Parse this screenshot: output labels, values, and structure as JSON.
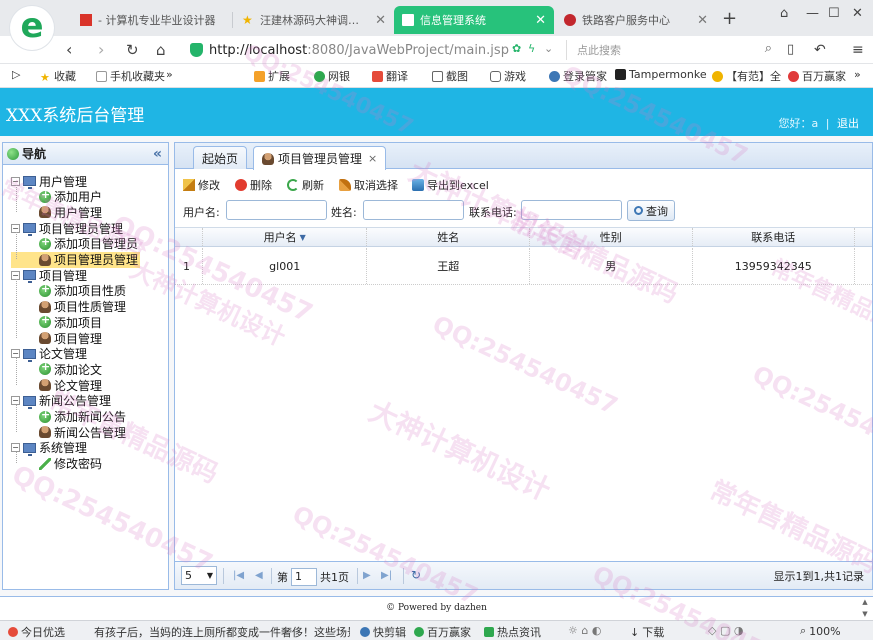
{
  "browser": {
    "tabs": [
      {
        "label": "- 计算机专业毕业设计器",
        "icon": "red-flag-icon"
      },
      {
        "label": "汪建林源码大神调试的C",
        "icon": "star-icon"
      },
      {
        "label": "信息管理系统",
        "icon": "document-icon",
        "active": true
      },
      {
        "label": "铁路客户服务中心",
        "icon": "railway-icon"
      }
    ],
    "new_tab": "+",
    "url_host": "http://localhost",
    "url_rest": ":8080/JavaWebProject/main.jsp",
    "search_placeholder": "点此搜索",
    "bookmarks": [
      "收藏",
      "手机收藏夹",
      "»",
      "扩展",
      "网银",
      "翻译",
      "截图",
      "游戏",
      "登录管家",
      "Tampermonke",
      "【有范】全",
      "百万赢家",
      "»"
    ]
  },
  "header": {
    "app_title": "XXX系统后台管理",
    "greeting": "您好：a",
    "separator": "|",
    "logout_label": "退出"
  },
  "sidebar": {
    "title": "导航",
    "groups": [
      {
        "label": "用户管理",
        "items": [
          "添加用户",
          "用户管理"
        ]
      },
      {
        "label": "项目管理员管理",
        "items": [
          "添加项目管理员",
          "项目管理员管理"
        ]
      },
      {
        "label": "项目管理",
        "items": [
          "添加项目性质",
          "项目性质管理",
          "添加项目",
          "项目管理"
        ]
      },
      {
        "label": "论文管理",
        "items": [
          "添加论文",
          "论文管理"
        ]
      },
      {
        "label": "新闻公告管理",
        "items": [
          "添加新闻公告",
          "新闻公告管理"
        ]
      },
      {
        "label": "系统管理",
        "items": [
          "修改密码"
        ]
      }
    ],
    "selected": "项目管理员管理"
  },
  "main": {
    "tabs": [
      {
        "label": "起始页"
      },
      {
        "label": "项目管理员管理",
        "close": "×"
      }
    ],
    "toolbar": {
      "edit": "修改",
      "delete": "删除",
      "refresh": "刷新",
      "cancel_select": "取消选择",
      "export": "导出到excel"
    },
    "search": {
      "username_label": "用户名:",
      "name_label": "姓名:",
      "phone_label": "联系电话:",
      "query_button": "查询"
    },
    "table": {
      "columns": [
        "用户名",
        "姓名",
        "性别",
        "联系电话"
      ],
      "rows": [
        {
          "num": "1",
          "cells": [
            "gl001",
            "王超",
            "男",
            "13959342345"
          ]
        }
      ]
    },
    "pager": {
      "page_size": "5",
      "page_prefix": "第",
      "page_value": "1",
      "page_suffix": "共1页",
      "summary": "显示1到1,共1记录"
    }
  },
  "footer": {
    "text": "© Powered by dazhen"
  },
  "statusbar": {
    "items": [
      "今日优选",
      "有孩子后，当妈的连上厕所都变成一件奢侈！这些场景",
      "快剪辑",
      "百万赢家",
      "热点资讯",
      "下载",
      "100%"
    ]
  },
  "watermark": {
    "lines": [
      "QQ:254540457",
      "大神计算机设计",
      "常年售精品源码"
    ]
  }
}
